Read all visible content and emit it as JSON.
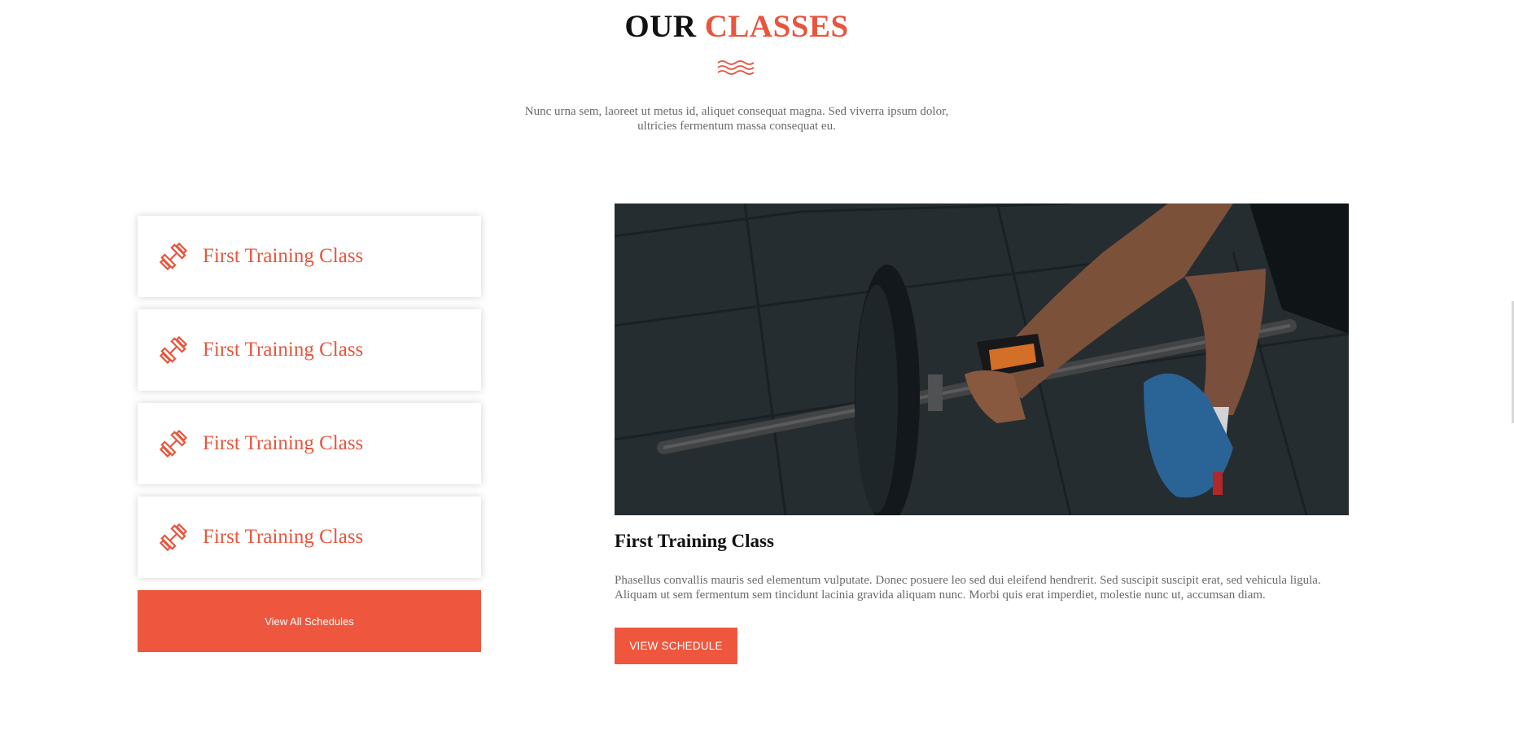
{
  "header": {
    "title_part1": "OUR",
    "title_part2": "CLASSES",
    "description": "Nunc urna sem, laoreet ut metus id, aliquet consequat magna. Sed viverra ipsum dolor, ultricies fermentum massa consequat eu."
  },
  "class_list": {
    "items": [
      {
        "label": "First Training Class",
        "icon": "dumbbell-icon"
      },
      {
        "label": "First Training Class",
        "icon": "dumbbell-icon"
      },
      {
        "label": "First Training Class",
        "icon": "dumbbell-icon"
      },
      {
        "label": "First Training Class",
        "icon": "dumbbell-icon"
      }
    ],
    "view_all_label": "View All Schedules"
  },
  "detail": {
    "title": "First Training Class",
    "text": "Phasellus convallis mauris sed elementum vulputate. Donec posuere leo sed dui eleifend hendrerit. Sed suscipit suscipit erat, sed vehicula ligula. Aliquam ut sem fermentum sem tincidunt lacinia gravida aliquam nunc. Morbi quis erat imperdiet, molestie nunc ut, accumsan diam.",
    "button_label": "VIEW SCHEDULE"
  },
  "colors": {
    "accent": "#ee573d",
    "text_dark": "#111111",
    "text_muted": "#6b6b6b"
  }
}
